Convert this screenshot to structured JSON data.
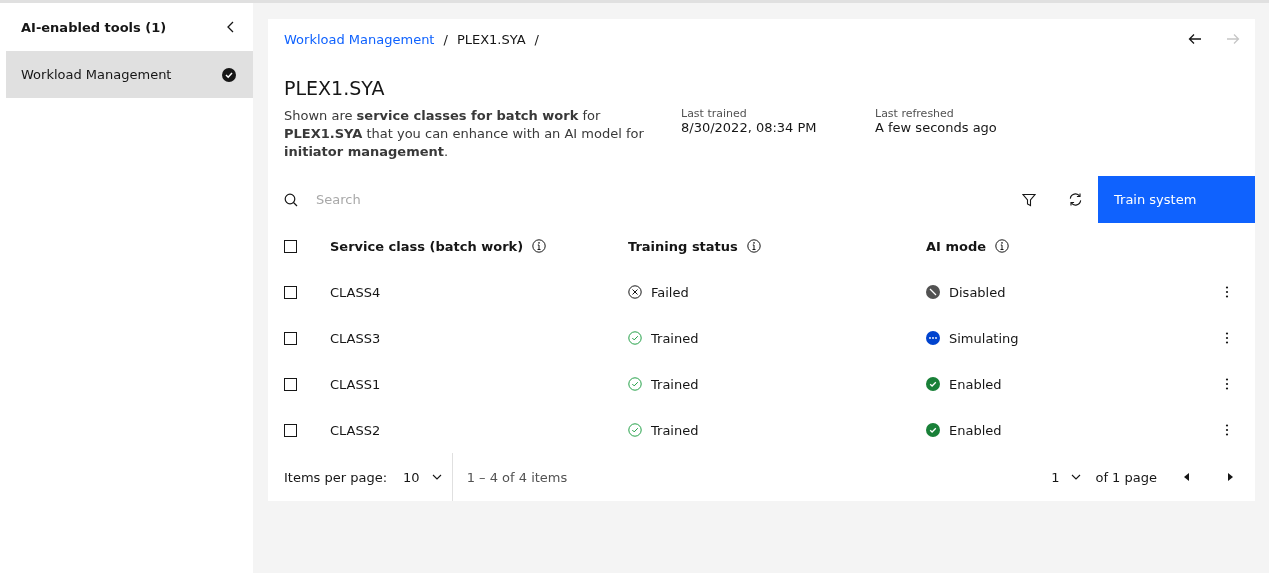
{
  "sidebar": {
    "title": "AI-enabled tools (1)",
    "items": [
      {
        "label": "Workload Management",
        "selected": true
      }
    ]
  },
  "breadcrumb": [
    {
      "label": "Workload Management",
      "kind": "link",
      "separator": "/"
    },
    {
      "label": "PLEX1.SYA",
      "kind": "current",
      "separator": "/"
    }
  ],
  "nav": [
    {
      "kind": "back",
      "disabled": false
    },
    {
      "kind": "forward",
      "disabled": true
    }
  ],
  "title": "PLEX1.SYA",
  "description": "Shown are **service classes for batch work** for **PLEX1.SYA** that you can enhance with an AI model for **initiator management**.",
  "meta": [
    {
      "label": "Last trained",
      "value": "8/30/2022, 08:34 PM"
    },
    {
      "label": "Last refreshed",
      "value": "A few seconds ago"
    }
  ],
  "search": {
    "placeholder": "Search"
  },
  "train_button": "Train system",
  "table": {
    "columns": [
      "Service class (batch work)",
      "Training status",
      "AI mode"
    ],
    "rows": [
      {
        "checked": false,
        "service_class": "CLASS4",
        "training_status": {
          "kind": "failed",
          "label": "Failed"
        },
        "ai_mode": {
          "kind": "disabled",
          "label": "Disabled"
        }
      },
      {
        "checked": false,
        "service_class": "CLASS3",
        "training_status": {
          "kind": "trained",
          "label": "Trained"
        },
        "ai_mode": {
          "kind": "simulating",
          "label": "Simulating"
        }
      },
      {
        "checked": false,
        "service_class": "CLASS1",
        "training_status": {
          "kind": "trained",
          "label": "Trained"
        },
        "ai_mode": {
          "kind": "enabled",
          "label": "Enabled"
        }
      },
      {
        "checked": false,
        "service_class": "CLASS2",
        "training_status": {
          "kind": "trained",
          "label": "Trained"
        },
        "ai_mode": {
          "kind": "enabled",
          "label": "Enabled"
        }
      }
    ]
  },
  "header_checked": false,
  "pagination": {
    "items_label": "Items per page:",
    "items_value": "10",
    "range": "1 – 4 of 4 items",
    "page": "1",
    "page_total": "of 1 page"
  }
}
